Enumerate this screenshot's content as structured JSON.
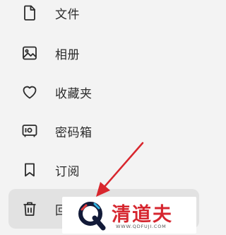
{
  "menu": {
    "items": [
      {
        "label": "文件",
        "icon": "document-icon"
      },
      {
        "label": "相册",
        "icon": "image-icon"
      },
      {
        "label": "收藏夹",
        "icon": "heart-icon"
      },
      {
        "label": "密码箱",
        "icon": "safe-icon"
      },
      {
        "label": "订阅",
        "icon": "bookmark-icon"
      },
      {
        "label": "回",
        "icon": "trash-icon",
        "selected": true
      }
    ]
  },
  "annotation": {
    "arrow_color": "#d8262d"
  },
  "watermark": {
    "brand": "清道夫",
    "url": "WWW.QDFUJI.COM",
    "brand_color": "#d6262f"
  }
}
